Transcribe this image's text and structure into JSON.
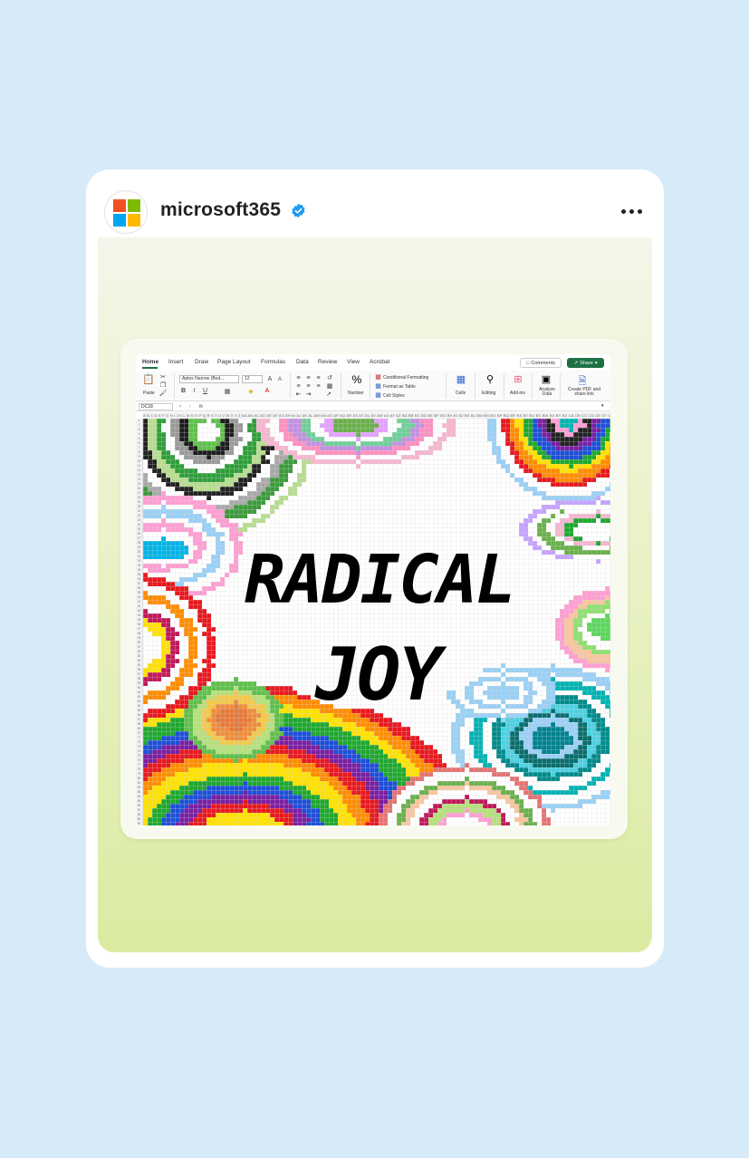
{
  "post": {
    "username": "microsoft365",
    "verified": true,
    "more_icon": "more-dots-icon",
    "logo_colors": [
      "#f25022",
      "#7fba00",
      "#00a4ef",
      "#ffb900"
    ]
  },
  "excel": {
    "tabs": [
      "Home",
      "Insert",
      "Draw",
      "Page Layout",
      "Formulas",
      "Data",
      "Review",
      "View",
      "Acrobat"
    ],
    "active_tab": "Home",
    "comments_label": "Comments",
    "share_label": "Share",
    "ribbon": {
      "paste_label": "Paste",
      "font_name": "Aptos Narrow (Bod...",
      "font_size": "12",
      "number_label": "Number",
      "conditional_formatting": "Conditional Formatting",
      "format_as_table": "Format as Table",
      "cell_styles": "Cell Styles",
      "cells_label": "Cells",
      "editing_label": "Editing",
      "addins_label": "Add-ins",
      "analyze_label": "Analyze Data",
      "create_pdf_label": "Create PDF and share link"
    },
    "name_box": "DC18",
    "fx_label": "fx",
    "column_headers": "A B C D E F G H I J K L M N O P Q R S T U V W X Y Z AA AB AC AD AE AF AG AH AI AJ AK AL AM AN AO AP AQ AR AS AT AU AV AW AX AY AZ BA BB BC BD BE BF BG BH BI BJ BK BL BM BN BO BP BQ BR BS BT BU BV BW BX BY BZ CA CB CC CD CE CF CG CH CI CJ CK CL CM CN CO CP CQ CR CS CT CU CV CW CX CY CZ",
    "row_count": 91
  },
  "artwork": {
    "text_line1": "RADICAL",
    "text_line2": "JOY",
    "rainbow_colors": [
      "#e8191f",
      "#ff8c00",
      "#ffe100",
      "#1fa82f",
      "#1e4fd8",
      "#7b1fa2"
    ],
    "accent_colors": [
      "#ff9ed2",
      "#9ad0f5",
      "#b5e07c",
      "#c5a3ff",
      "#00b3b3",
      "#ffffff"
    ]
  }
}
